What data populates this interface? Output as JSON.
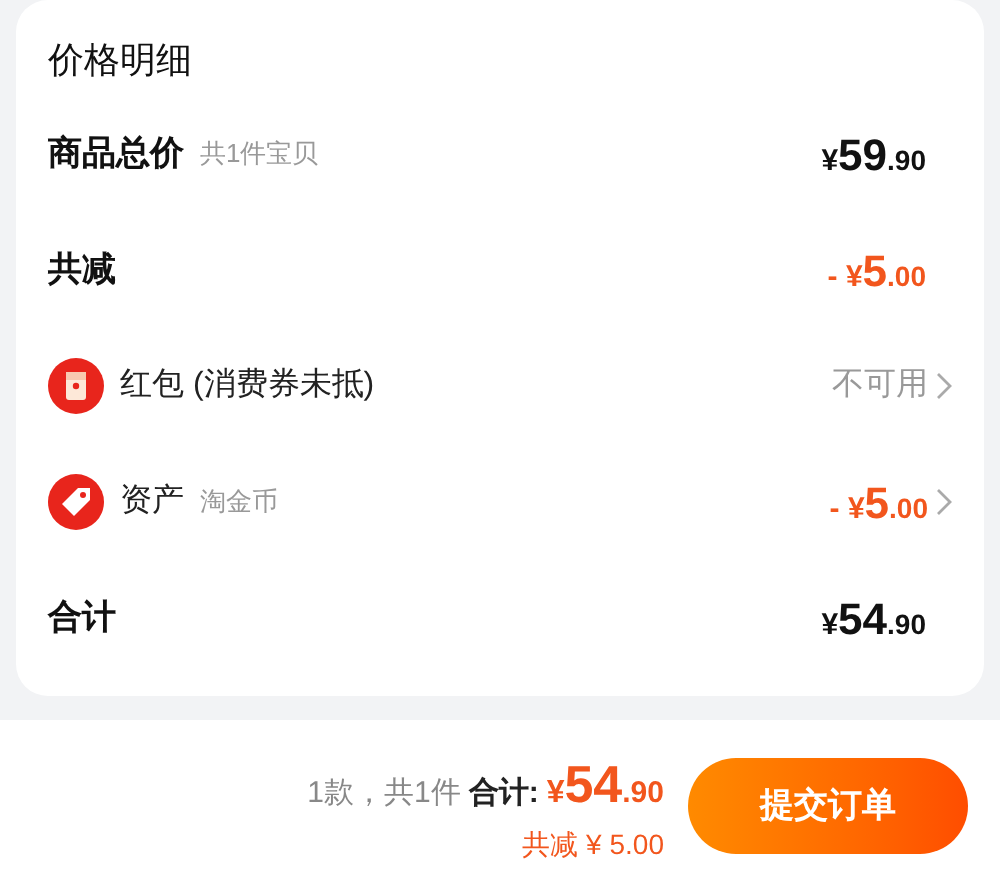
{
  "card": {
    "title": "价格明细",
    "rows": [
      {
        "kind": "plain",
        "label": "商品总价",
        "note": "共1件宝贝",
        "amount": {
          "currency": "¥",
          "integer": "59",
          "decimal": ".90"
        },
        "discount": false,
        "chevron": false
      },
      {
        "kind": "plain",
        "label": "共减",
        "amount": {
          "sign": "- ",
          "currency": "¥",
          "integer": "5",
          "decimal": ".00"
        },
        "discount": true,
        "chevron": false
      },
      {
        "kind": "envelope",
        "label": "红包 (消费券未抵)",
        "status": "不可用",
        "chevron": true
      },
      {
        "kind": "tag",
        "label": "资产",
        "note": "淘金币",
        "amount": {
          "sign": "- ",
          "currency": "¥",
          "integer": "5",
          "decimal": ".00"
        },
        "discount": true,
        "chevron": true
      },
      {
        "kind": "plain",
        "label": "合计",
        "amount": {
          "currency": "¥",
          "integer": "54",
          "decimal": ".90"
        },
        "discount": false,
        "chevron": false
      }
    ]
  },
  "footer": {
    "count": "1款，共1件",
    "total_label": "合计:",
    "total": {
      "currency": "¥",
      "integer": "54",
      "decimal": ".90"
    },
    "saving": "共减 ¥ 5.00",
    "submit": "提交订单"
  }
}
